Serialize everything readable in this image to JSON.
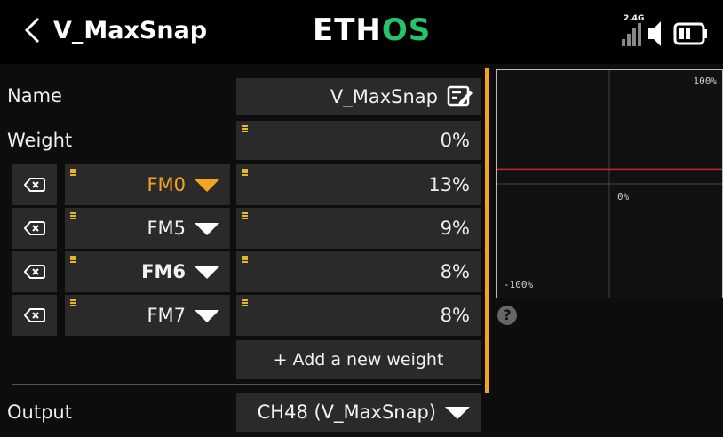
{
  "header": {
    "title": "V_MaxSnap",
    "logo_a": "ETH",
    "logo_b": "OS",
    "rf_label": "2.4G"
  },
  "form": {
    "name_label": "Name",
    "name_value": "V_MaxSnap",
    "weight_label": "Weight",
    "weight_value": "0%",
    "weights": [
      {
        "mode": "FM0",
        "value": "13%",
        "active": true
      },
      {
        "mode": "FM5",
        "value": "9%"
      },
      {
        "mode": "FM6",
        "value": "8%",
        "bold": true
      },
      {
        "mode": "FM7",
        "value": "8%"
      }
    ],
    "add_label": "+ Add a new weight",
    "output_label": "Output",
    "output_value": "CH48 (V_MaxSnap)"
  },
  "curve": {
    "top_label": "100%",
    "mid_label": "0%",
    "bottom_label": "-100%",
    "line_value": 0.13,
    "line_color": "#c62828"
  },
  "help_glyph": "?",
  "colors": {
    "accent": "#f3a521",
    "logo_green": "#27c36a"
  }
}
